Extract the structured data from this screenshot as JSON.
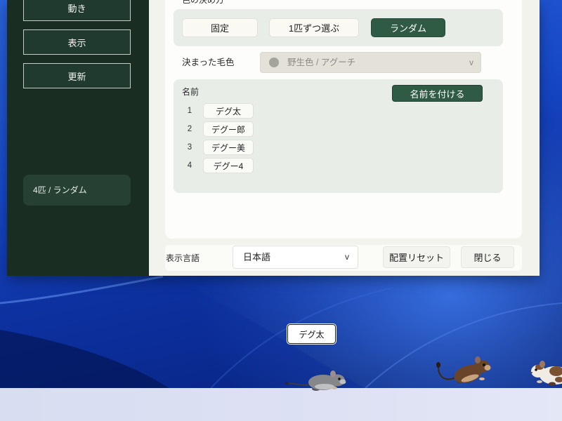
{
  "window": {
    "sidebar": {
      "items": [
        {
          "label": "動き"
        },
        {
          "label": "表示"
        },
        {
          "label": "更新"
        }
      ],
      "status": "4匹 / ランダム"
    },
    "color_method": {
      "label": "色の決め方",
      "options": [
        "固定",
        "1匹ずつ選ぶ",
        "ランダム"
      ],
      "selected_index": 2
    },
    "fixed_color": {
      "label": "決まった毛色",
      "value": "野生色 / アグーチ",
      "chevron": "v",
      "disabled": true,
      "swatch_color": "#a4a39c"
    },
    "names": {
      "label": "名前",
      "assign_button": "名前を付ける",
      "list": [
        {
          "index": "1",
          "name": "デグ太"
        },
        {
          "index": "2",
          "name": "デグー郎"
        },
        {
          "index": "3",
          "name": "デグー美"
        },
        {
          "index": "4",
          "name": "デグー4"
        }
      ]
    },
    "footer": {
      "language_label": "表示言語",
      "language_value": "日本語",
      "chevron": "v",
      "reset_button": "配置リセット",
      "close_button": "閉じる"
    }
  },
  "desktop": {
    "name_tag": "デグ太",
    "pets": [
      {
        "fur_color": "#85878b",
        "belly_color": "#bfc0c2"
      },
      {
        "fur_color": "#6a4429",
        "belly_color": "#c9a37c"
      },
      {
        "fur_color": "#7b5133",
        "belly_color": "#f0ebe3"
      }
    ]
  },
  "colors": {
    "accent": "#2f5a44",
    "sidebar": "#1a2d23",
    "panel": "#e8ede8"
  }
}
